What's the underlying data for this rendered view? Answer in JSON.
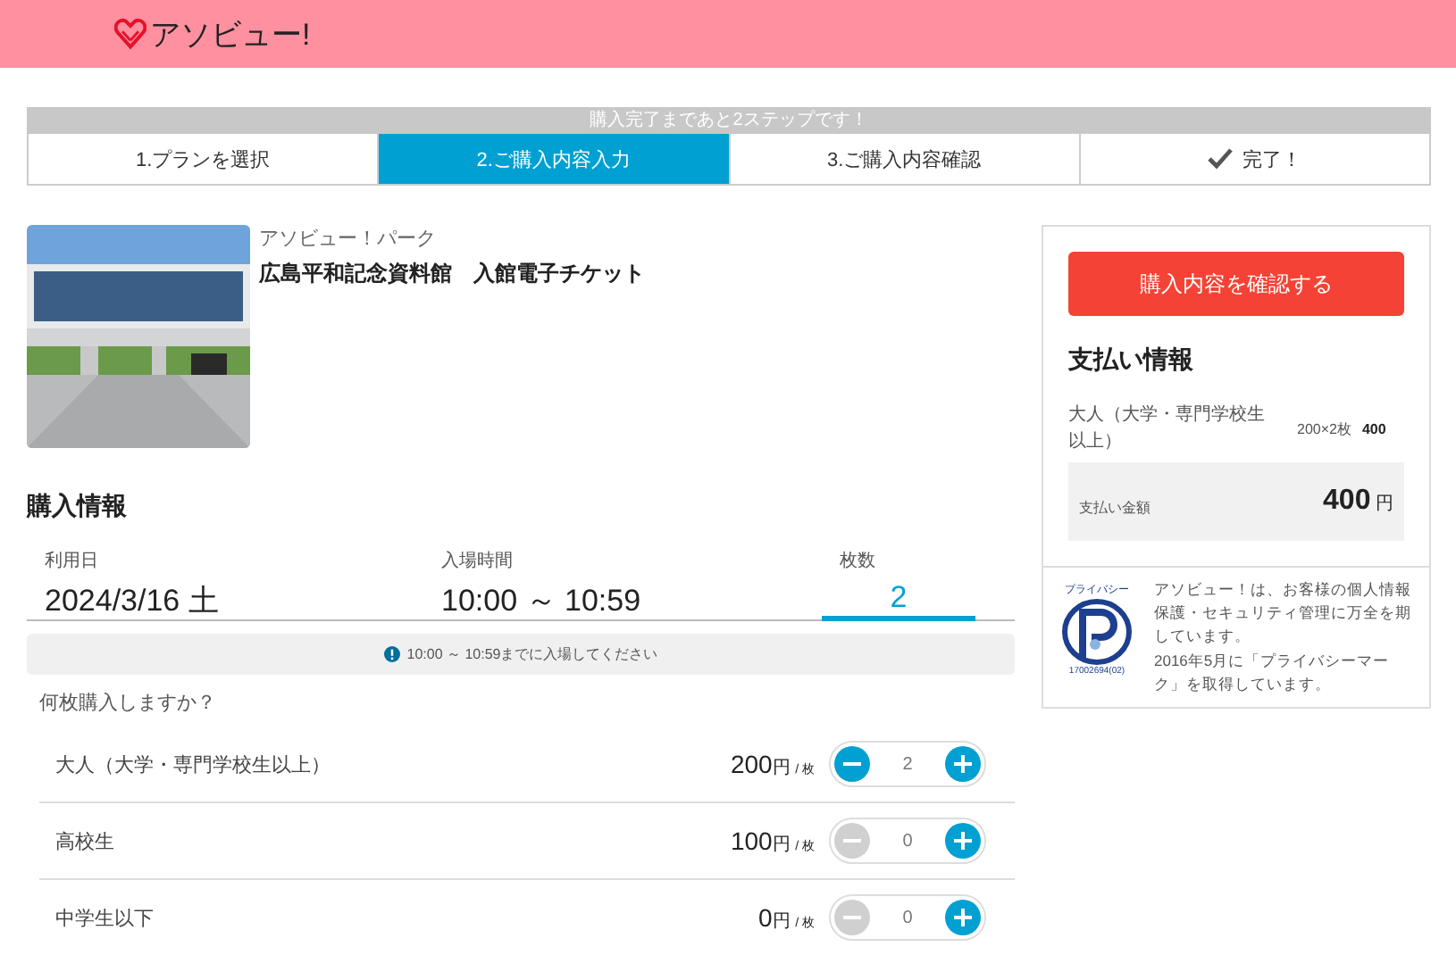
{
  "header": {
    "logo_text": "アソビュー!"
  },
  "progress": {
    "message": "購入完了まであと2ステップです！",
    "steps": [
      {
        "label": "1.プランを選択",
        "selected": false,
        "kind": "text"
      },
      {
        "label": "2.ご購入内容入力",
        "selected": true,
        "kind": "text"
      },
      {
        "label": "3.ご購入内容確認",
        "selected": false,
        "kind": "text"
      },
      {
        "label": "完了！",
        "selected": false,
        "kind": "check"
      }
    ]
  },
  "product": {
    "provider": "アソビュー！パーク",
    "title": "広島平和記念資料館　入館電子チケット"
  },
  "purchase_info": {
    "heading": "購入情報",
    "fields": [
      {
        "label": "利用日",
        "value": "2024/3/16 土",
        "selected": false
      },
      {
        "label": "入場時間",
        "value": "10:00 ～ 10:59",
        "selected": false
      },
      {
        "label": "枚数",
        "value": "2",
        "selected": true
      }
    ],
    "notice": "10:00 ～ 10:59までに入場してください",
    "question": "何枚購入しますか？",
    "tickets": [
      {
        "name": "大人（大学・専門学校生以上）",
        "price": "200",
        "unit": "円",
        "per": "/ 枚",
        "count": "2",
        "minus_disabled": false
      },
      {
        "name": "高校生",
        "price": "100",
        "unit": "円",
        "per": "/ 枚",
        "count": "0",
        "minus_disabled": true
      },
      {
        "name": "中学生以下",
        "price": "0",
        "unit": "円",
        "per": "/ 枚",
        "count": "0",
        "minus_disabled": true
      }
    ]
  },
  "sidebar": {
    "confirm_button": "購入内容を確認する",
    "payment_heading": "支払い情報",
    "lines": [
      {
        "name": "大人（大学・専門学校生以上）",
        "detail": "200×2枚",
        "amount": "400"
      }
    ],
    "total_label": "支払い金額",
    "total": "400",
    "total_unit": "円",
    "privacy_mark": {
      "arc_text": "プライバシー",
      "number": "17002694(02)"
    },
    "privacy_text": "アソビュー！は、お客様の個人情報保護・セキュリティ管理に万全を期しています。\n2016年5月に「プライバシーマーク」を取得しています。"
  }
}
